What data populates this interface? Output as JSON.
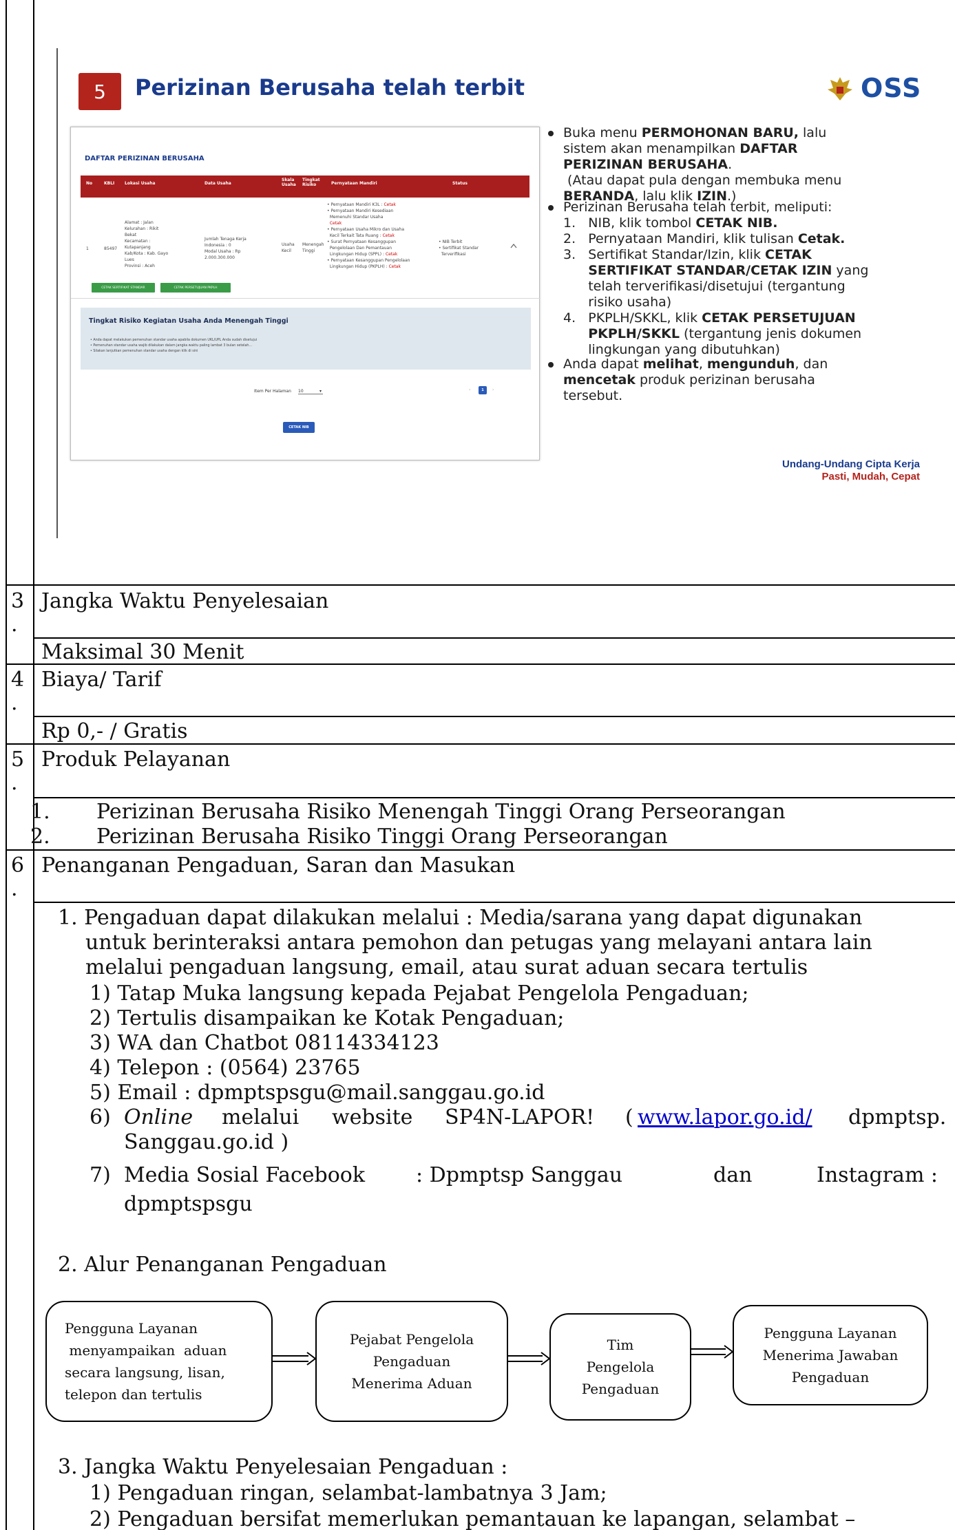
{
  "slide": {
    "number": "5",
    "title": "Perizinan Berusaha telah terbit",
    "logo_text": "OSS",
    "screenshot": {
      "title": "DAFTAR PERIZINAN BERUSAHA",
      "columns": [
        "No",
        "KBLI",
        "Lokasi Usaha",
        "Data Usaha",
        "Skala Usaha",
        "Tingkat Risiko",
        "Pernyataan Mandiri",
        "Status"
      ],
      "row": {
        "no": "1",
        "kbli": "85497",
        "lokasi": [
          "Alamat : Jalan",
          "Kelurahan : Rikit",
          "Bekat",
          "Kecamatan :",
          "Kutapanjang",
          "Kab/Kota : Kab. Gayo",
          "Lues",
          "Provinsi : Aceh"
        ],
        "data": [
          "Jumlah Tenaga Kerja",
          "Indonesia : 0",
          "Modal Usaha : Rp",
          "2.000.300.000"
        ],
        "skala": [
          "Usaha",
          "Kecil"
        ],
        "risiko": [
          "Menengah",
          "Tinggi"
        ],
        "pernyataan": [
          [
            "• Pernyataan Mandiri K3L : ",
            "Cetak"
          ],
          [
            "• Pernyataan Mandiri Kesediaan",
            ""
          ],
          [
            "  Memenuhi Standar Usaha",
            ""
          ],
          [
            "  ",
            "Cetak"
          ],
          [
            "• Pernyataan Usaha Mikro dan Usaha",
            ""
          ],
          [
            "  Kecil Terkait Tata Ruang : ",
            "Cetak"
          ],
          [
            "• Surat Pernyataan Kesanggupan",
            ""
          ],
          [
            "  Pengelolaan Dan Pemantauan",
            ""
          ],
          [
            "  Lingkungan Hidup (SPPL) : ",
            "Cetak"
          ],
          [
            "• Pernyataan Kesanggupan Pengelolaan",
            ""
          ],
          [
            "  Lingkungan Hidup (PKPLH) : ",
            "Cetak"
          ]
        ],
        "status": [
          "• NIB Terbit",
          "• Sertifikat Standar",
          "  Terverifikasi"
        ]
      },
      "btn_sertifikat": "CETAK SERTIFIKAT STANDAR",
      "btn_persetujuan": "CETAK PERSETUJUAN PKPLH",
      "risk_title": "Tingkat Risiko Kegiatan Usaha Anda Menengah Tinggi",
      "risk_items": [
        "• Anda dapat melakukan pemenuhan standar usaha apabila dokumen UKL/UPL Anda sudah disetujui",
        "• Pemenuhan standar usaha wajib dilakukan dalam jangka waktu paling lambat 3 bulan setelah...",
        "• Silakan lanjutkan pemenuhan standar usaha dengan klik di sini"
      ],
      "pager_label": "Item Per Halaman",
      "pager_value": "10",
      "page_current": "1",
      "btn_nib": "CETAK NIB"
    },
    "bullets": [
      [
        [
          [
            "Buka menu ",
            false
          ],
          [
            "PERMOHONAN BARU,",
            true
          ],
          [
            " lalu",
            false
          ]
        ],
        [
          [
            "sistem akan menampilkan ",
            false
          ],
          [
            "DAFTAR",
            true
          ]
        ],
        [
          [
            "PERIZINAN BERUSAHA",
            true
          ],
          [
            ".",
            false
          ]
        ],
        [
          [
            " (Atau dapat pula dengan membuka menu",
            false
          ]
        ],
        [
          [
            "BERANDA",
            true
          ],
          [
            ", lalu klik ",
            false
          ],
          [
            "IZIN",
            true
          ],
          [
            ".)",
            false
          ]
        ]
      ],
      [
        [
          [
            "Perizinan Berusaha telah terbit, meliputi:",
            false
          ]
        ],
        [
          [
            "1.   NIB, klik tombol ",
            false
          ],
          [
            "CETAK NIB.",
            true
          ]
        ],
        [
          [
            "2.   Pernyataan Mandiri, klik tulisan ",
            false
          ],
          [
            "Cetak.",
            true
          ]
        ],
        [
          [
            "3.   Sertifikat Standar/Izin, klik ",
            false
          ],
          [
            "CETAK",
            true
          ]
        ],
        [
          [
            "      ",
            false
          ],
          [
            "SERTIFIKAT STANDAR/CETAK IZIN",
            true
          ],
          [
            " yang",
            false
          ]
        ],
        [
          [
            "      telah terverifikasi/disetujui (tergantung",
            false
          ]
        ],
        [
          [
            "      risiko usaha)",
            false
          ]
        ],
        [
          [
            "4.   PKPLH/SKKL, klik ",
            false
          ],
          [
            "CETAK PERSETUJUAN",
            true
          ]
        ],
        [
          [
            "      ",
            false
          ],
          [
            "PKPLH/SKKL",
            true
          ],
          [
            " (tergantung jenis dokumen",
            false
          ]
        ],
        [
          [
            "      lingkungan yang dibutuhkan)",
            false
          ]
        ]
      ],
      [
        [
          [
            "Anda dapat ",
            false
          ],
          [
            "melihat",
            true
          ],
          [
            ", ",
            false
          ],
          [
            "mengunduh",
            true
          ],
          [
            ", dan",
            false
          ]
        ],
        [
          [
            "mencetak",
            true
          ],
          [
            " produk perizinan berusaha",
            false
          ]
        ],
        [
          [
            "tersebut.",
            false
          ]
        ]
      ]
    ],
    "footer_law": [
      "Undang-Undang Cipta Kerja",
      "Pasti, Mudah, Cepat"
    ]
  },
  "sections": {
    "s3_num": "3",
    "s3_dot": ".",
    "s3_title": "Jangka Waktu Penyelesaian",
    "s3_value": "Maksimal 30 Menit",
    "s4_num": "4",
    "s4_dot": ".",
    "s4_title": "Biaya/ Tarif",
    "s4_value": "Rp 0,- / Gratis",
    "s5_num": "5",
    "s5_dot": ".",
    "s5_title": "Produk Pelayanan",
    "s5_items": [
      [
        "1.",
        "Perizinan Berusaha Risiko Menengah Tinggi Orang Perseorangan"
      ],
      [
        "2.",
        "Perizinan Berusaha Risiko Tinggi  Orang Perseorangan"
      ]
    ],
    "s6_num": "6",
    "s6_dot": ".",
    "s6_title": "Penanganan Pengaduan, Saran dan Masukan"
  },
  "complaint": {
    "intro": [
      "1. Pengaduan dapat dilakukan melalui : Media/sarana yang dapat digunakan",
      "untuk berinteraksi antara pemohon dan petugas yang melayani antara lain",
      "melalui pengaduan langsung, email, atau surat aduan secara tertulis"
    ],
    "items": [
      "1)  Tatap Muka langsung kepada Pejabat Pengelola Pengaduan;",
      "2)  Tertulis disampaikan ke Kotak Pengaduan;",
      "3)  WA dan Chatbot  08114334123",
      "4)  Telepon : (0564) 23765",
      "5)  Email : dpmptspsgu@mail.sanggau.go.id"
    ],
    "item6_num": "6)",
    "item6_online": "Online",
    "item6_via": "melalui",
    "item6_site": "website",
    "item6_lapor": "SP4N-LAPOR!",
    "item6_open": "(",
    "item6_link": "www.lapor.go.id/",
    "item6_tail": "dpmptsp.",
    "item6_line2": "Sanggau.go.id )",
    "item7_num": "7)",
    "item7_a": "Media Sosial Facebook",
    "item7_b": ": Dpmptsp  Sanggau",
    "item7_c": "dan",
    "item7_d": "Instagram  :",
    "item7_line2": "dpmptspsgu",
    "flow_title": "2. Alur Penanganan Pengaduan",
    "flow": [
      [
        "Pengguna Layanan",
        " menyampaikan  aduan",
        "secara langsung,  lisan,",
        "telepon dan tertulis"
      ],
      [
        "Pejabat Pengelola",
        "Pengaduan",
        "Menerima Aduan"
      ],
      [
        "Tim",
        "Pengelola",
        "Pengaduan"
      ],
      [
        "Pengguna Layanan",
        "Menerima Jawaban",
        "Pengaduan"
      ]
    ],
    "time_title": "3. Jangka Waktu Penyelesaian Pengaduan :",
    "time_items": [
      "1)  Pengaduan ringan, selambat-lambatnya 3 Jam;",
      "2)  Pengaduan bersifat memerlukan pemantauan ke lapangan, selambat –"
    ]
  }
}
